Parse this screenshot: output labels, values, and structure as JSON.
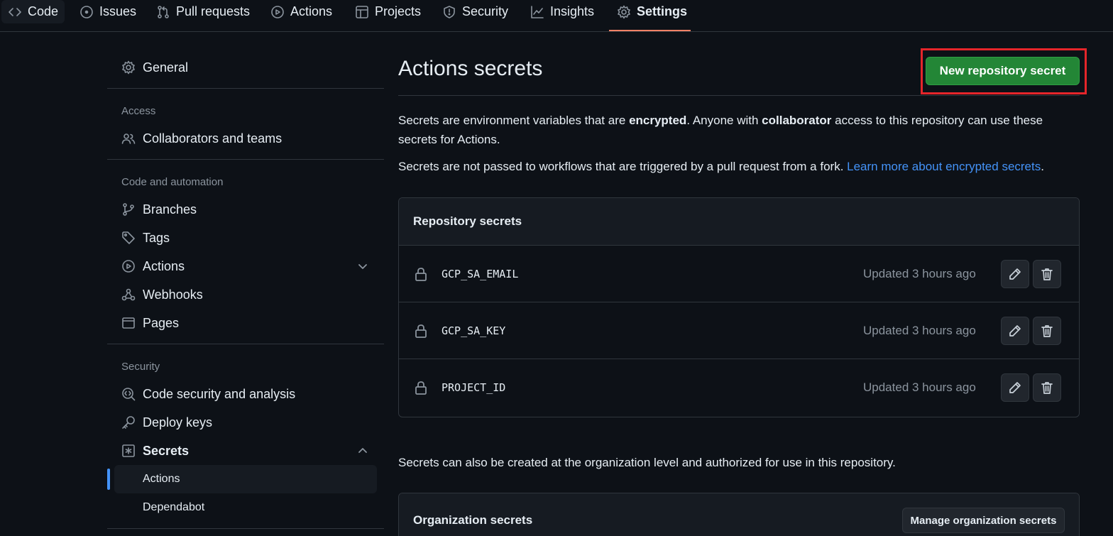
{
  "topnav": {
    "tabs": [
      {
        "label": "Code",
        "icon": "code-icon"
      },
      {
        "label": "Issues",
        "icon": "issue-circle-icon"
      },
      {
        "label": "Pull requests",
        "icon": "pull-request-icon"
      },
      {
        "label": "Actions",
        "icon": "play-circle-icon"
      },
      {
        "label": "Projects",
        "icon": "table-icon"
      },
      {
        "label": "Security",
        "icon": "shield-icon"
      },
      {
        "label": "Insights",
        "icon": "graph-icon"
      },
      {
        "label": "Settings",
        "icon": "gear-icon"
      }
    ],
    "active_tab": "Settings",
    "active_color": "#f78166"
  },
  "sidebar": {
    "general": "General",
    "access_heading": "Access",
    "collaborators": "Collaborators and teams",
    "code_heading": "Code and automation",
    "branches": "Branches",
    "tags": "Tags",
    "actions": "Actions",
    "webhooks": "Webhooks",
    "pages": "Pages",
    "security_heading": "Security",
    "code_security": "Code security and analysis",
    "deploy_keys": "Deploy keys",
    "secrets": "Secrets",
    "secrets_sub": {
      "actions": "Actions",
      "dependabot": "Dependabot"
    },
    "selected_item": "Actions"
  },
  "main": {
    "title": "Actions secrets",
    "new_button": "New repository secret",
    "intro": {
      "part1": "Secrets are environment variables that are ",
      "bold1": "encrypted",
      "part2": ". Anyone with ",
      "bold2": "collaborator",
      "part3": " access to this repository can use these secrets for Actions."
    },
    "fork_note": "Secrets are not passed to workflows that are triggered by a pull request from a fork. ",
    "fork_link": "Learn more about encrypted secrets",
    "fork_end": ".",
    "repo_secrets": {
      "heading": "Repository secrets",
      "items": [
        {
          "name": "GCP_SA_EMAIL",
          "updated": "Updated 3 hours ago"
        },
        {
          "name": "GCP_SA_KEY",
          "updated": "Updated 3 hours ago"
        },
        {
          "name": "PROJECT_ID",
          "updated": "Updated 3 hours ago"
        }
      ]
    },
    "org_note": "Secrets can also be created at the organization level and authorized for use in this repository.",
    "org_secrets": {
      "heading": "Organization secrets",
      "manage_button": "Manage organization secrets"
    }
  },
  "colors": {
    "background": "#0d1117",
    "primary_button": "#238636",
    "link": "#4493f8",
    "highlight_box": "#e5252a"
  }
}
